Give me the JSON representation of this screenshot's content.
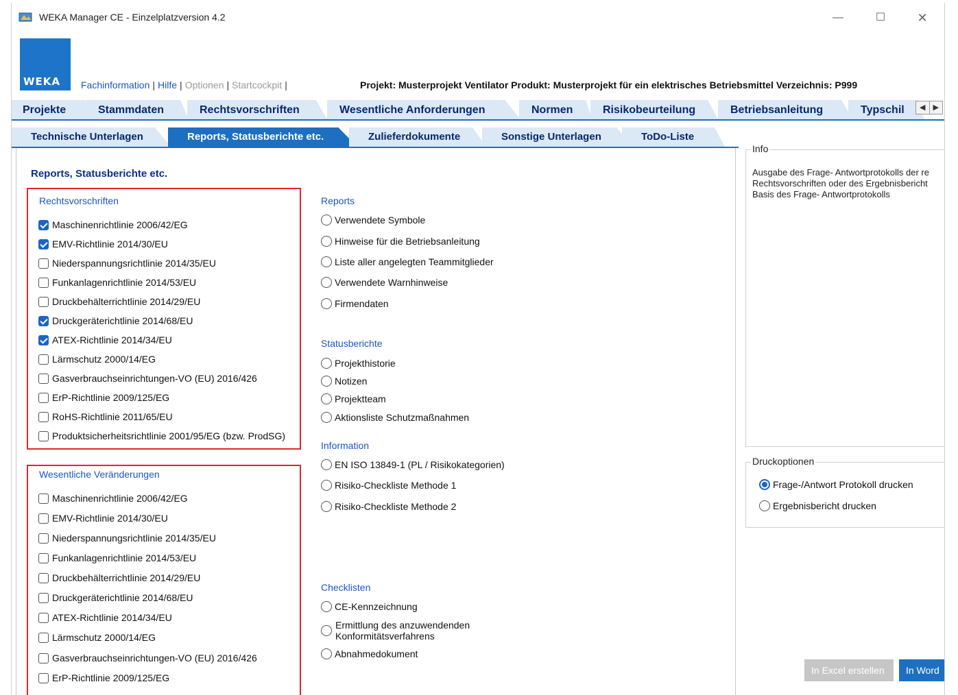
{
  "window": {
    "title": "WEKA Manager CE - Einzelplatzversion 4.2",
    "controls": {
      "minimize": "—",
      "maximize": "☐",
      "close": "✕"
    }
  },
  "logo": {
    "text": "WEKA",
    "color": "#1d74c8"
  },
  "toplinks": {
    "fachinformation": "Fachinformation",
    "hilfe": "Hilfe",
    "optionen": "Optionen",
    "startcockpit": "Startcockpit",
    "separator": "|"
  },
  "projectinfo": "Projekt: Musterprojekt Ventilator   Produkt: Musterprojekt für ein elektrisches Betriebsmittel   Verzeichnis: P999",
  "main_tabs": [
    "Projekte",
    "Stammdaten",
    "Rechtsvorschriften",
    "Wesentliche Anforderungen",
    "Normen",
    "Risikobeurteilung",
    "Betriebsanleitung",
    "Typschil"
  ],
  "scroll_arrows": {
    "left": "◀",
    "right": "▶"
  },
  "sub_tabs": [
    {
      "label": "Technische Unterlagen",
      "active": false
    },
    {
      "label": "Reports, Statusberichte etc.",
      "active": true
    },
    {
      "label": "Zulieferdokumente",
      "active": false
    },
    {
      "label": "Sonstige Unterlagen",
      "active": false
    },
    {
      "label": "ToDo-Liste",
      "active": false
    }
  ],
  "page_title": "Reports, Statusberichte etc.",
  "rechtsvorschriften": {
    "heading": "Rechtsvorschriften",
    "items": [
      {
        "label": "Maschinenrichtlinie 2006/42/EG",
        "checked": true
      },
      {
        "label": "EMV-Richtlinie 2014/30/EU",
        "checked": true
      },
      {
        "label": "Niederspannungsrichtlinie 2014/35/EU",
        "checked": false
      },
      {
        "label": "Funkanlagenrichtlinie 2014/53/EU",
        "checked": false
      },
      {
        "label": "Druckbehälterrichtlinie 2014/29/EU",
        "checked": false
      },
      {
        "label": "Druckgeräterichtlinie 2014/68/EU",
        "checked": true
      },
      {
        "label": "ATEX-Richtlinie 2014/34/EU",
        "checked": true
      },
      {
        "label": "Lärmschutz 2000/14/EG",
        "checked": false
      },
      {
        "label": "Gasverbrauchseinrichtungen-VO (EU) 2016/426",
        "checked": false
      },
      {
        "label": "ErP-Richtlinie 2009/125/EG",
        "checked": false
      },
      {
        "label": "RoHS-Richtlinie 2011/65/EU",
        "checked": false
      },
      {
        "label": "Produktsicherheitsrichtlinie 2001/95/EG  (bzw. ProdSG)",
        "checked": false
      }
    ]
  },
  "wesentliche": {
    "heading": "Wesentliche Veränderungen",
    "items": [
      {
        "label": "Maschinenrichtlinie 2006/42/EG",
        "checked": false
      },
      {
        "label": "EMV-Richtlinie 2014/30/EU",
        "checked": false
      },
      {
        "label": "Niederspannungsrichtlinie 2014/35/EU",
        "checked": false
      },
      {
        "label": "Funkanlagenrichtlinie 2014/53/EU",
        "checked": false
      },
      {
        "label": "Druckbehälterrichtlinie 2014/29/EU",
        "checked": false
      },
      {
        "label": "Druckgeräterichtlinie 2014/68/EU",
        "checked": false
      },
      {
        "label": "ATEX-Richtlinie 2014/34/EU",
        "checked": false
      },
      {
        "label": "Lärmschutz 2000/14/EG",
        "checked": false
      },
      {
        "label": "Gasverbrauchseinrichtungen-VO (EU) 2016/426",
        "checked": false
      },
      {
        "label": "ErP-Richtlinie 2009/125/EG",
        "checked": false
      }
    ]
  },
  "reports": {
    "heading": "Reports",
    "items": [
      "Verwendete Symbole",
      "Hinweise für die Betriebsanleitung",
      "Liste aller angelegten Teammitglieder",
      "Verwendete Warnhinweise",
      "Firmendaten"
    ]
  },
  "statusberichte": {
    "heading": "Statusberichte",
    "items": [
      "Projekthistorie",
      "Notizen",
      "Projektteam",
      "Aktionsliste Schutzmaßnahmen"
    ]
  },
  "information": {
    "heading": "Information",
    "items": [
      "EN ISO 13849-1 (PL / Risikokategorien)",
      "Risiko-Checkliste Methode 1",
      "Risiko-Checkliste Methode 2"
    ]
  },
  "checklisten": {
    "heading": "Checklisten",
    "items": [
      {
        "line1": "CE-Kennzeichnung"
      },
      {
        "line1": "Ermittlung des anzuwendenden",
        "line2": "Konformitätsverfahrens"
      },
      {
        "line1": "Abnahmedokument"
      }
    ]
  },
  "info_panel": {
    "legend": "Info",
    "text": "Ausgabe des Frage- Antwortprotokolls der re Rechtsvorschriften oder des Ergebnisbericht Basis des Frage- Antwortprotokolls"
  },
  "druckoptionen": {
    "legend": "Druckoptionen",
    "options": [
      {
        "label": "Frage-/Antwort Protokoll drucken",
        "checked": true
      },
      {
        "label": "Ergebnisbericht drucken",
        "checked": false
      }
    ]
  },
  "buttons": {
    "excel": "In Excel erstellen",
    "word": "In Word"
  },
  "colors": {
    "accent": "#1d6fc1",
    "highlight_box": "#e0262c",
    "tab_bg": "#dbe8f6",
    "tab_text": "#08276b"
  }
}
